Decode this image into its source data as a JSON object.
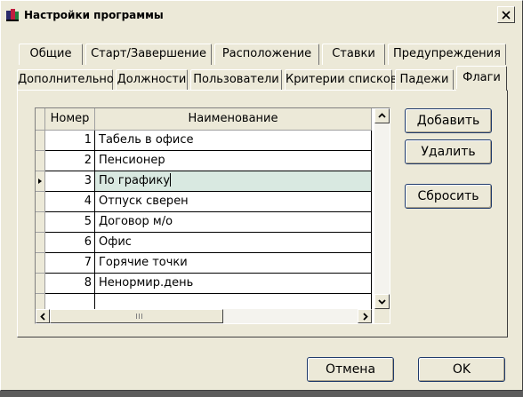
{
  "window": {
    "title": "Настройки программы"
  },
  "tabs_row1": [
    "Общие",
    "Старт/Завершение",
    "Расположение",
    "Ставки",
    "Предупреждения"
  ],
  "tabs_row2": [
    "Дополнительно",
    "Должности",
    "Пользователи",
    "Критерии списков",
    "Падежи",
    "Флаги"
  ],
  "active_tab": "Флаги",
  "table": {
    "columns": [
      "Номер",
      "Наименование"
    ],
    "rows": [
      {
        "num": "1",
        "name": "Табель в офисе"
      },
      {
        "num": "2",
        "name": "Пенсионер"
      },
      {
        "num": "3",
        "name": "По графику"
      },
      {
        "num": "4",
        "name": "Отпуск сверен"
      },
      {
        "num": "5",
        "name": "Договор м/о"
      },
      {
        "num": "6",
        "name": "Офис"
      },
      {
        "num": "7",
        "name": "Горячие точки"
      },
      {
        "num": "8",
        "name": "Ненормир.день"
      },
      {
        "num": "",
        "name": ""
      }
    ],
    "selected_row": 3
  },
  "side_buttons": {
    "add": "Добавить",
    "delete": "Удалить",
    "reset": "Сбросить"
  },
  "footer_buttons": {
    "cancel": "Отмена",
    "ok": "OK"
  },
  "icons": {
    "app": "app-icon",
    "close": "close-icon",
    "scroll_up": "scroll-up-icon",
    "scroll_down": "scroll-down-icon",
    "scroll_left": "scroll-left-icon",
    "scroll_right": "scroll-right-icon",
    "row_pointer": "row-pointer-icon"
  },
  "colors": {
    "dialog_bg": "#ece9d8",
    "selected_cell": "#d9e9e1",
    "button_border": "#1f3a6b"
  }
}
